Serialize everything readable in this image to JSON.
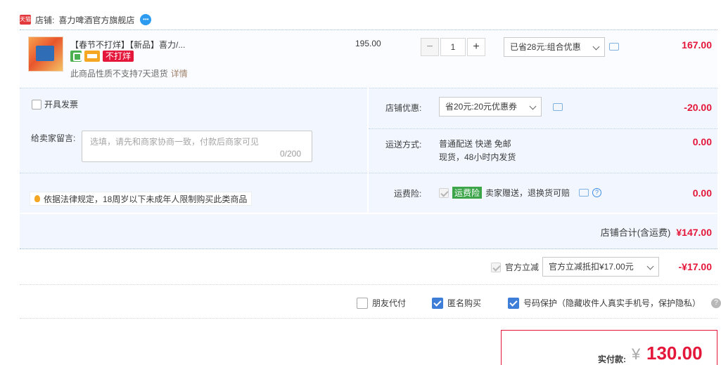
{
  "shop": {
    "badge": "天猫",
    "label": "店铺:",
    "name": "喜力啤酒官方旗舰店"
  },
  "item": {
    "title": "【春节不打烊】【新品】喜力/...",
    "tag": "不打烊",
    "return_note": "此商品性质不支持7天退货",
    "detail_link": "详情",
    "unit_price": "195.00",
    "quantity": "1",
    "minus": "−",
    "plus": "+",
    "promo": "已省28元:组合优惠",
    "total": "167.00"
  },
  "invoice": {
    "label": "开具发票"
  },
  "message": {
    "label": "给卖家留言:",
    "placeholder": "选填，请先和商家协商一致，付款后商家可见",
    "count": "0/200"
  },
  "legal_notice": "依据法律规定，18周岁以下未成年人限制购买此类商品",
  "shop_discount": {
    "label": "店铺优惠:",
    "select": "省20元:20元优惠券",
    "amount": "-20.00"
  },
  "shipping": {
    "label": "运送方式:",
    "line1": "普通配送 快递 免邮",
    "line2": "现货，48小时内发货",
    "amount": "0.00"
  },
  "insurance": {
    "label": "运费险:",
    "badge": "运费险",
    "text": "卖家赠送，退换货可赔",
    "amount": "0.00"
  },
  "subtotal": {
    "label": "店铺合计(含运费)",
    "amount": "¥147.00"
  },
  "official": {
    "label": "官方立减",
    "select": "官方立减抵扣¥17.00元",
    "amount": "-¥17.00"
  },
  "options": {
    "friend_pay": "朋友代付",
    "anonymous": "匿名购买",
    "number_protect": "号码保护（隐藏收件人真实手机号，保护隐私）"
  },
  "payment": {
    "label": "实付款:",
    "currency": "¥",
    "amount": "130.00"
  },
  "colors": {
    "accent_red": "#e4163a",
    "panel_blue": "#f2f7ff",
    "check_blue": "#3f7ed8"
  }
}
